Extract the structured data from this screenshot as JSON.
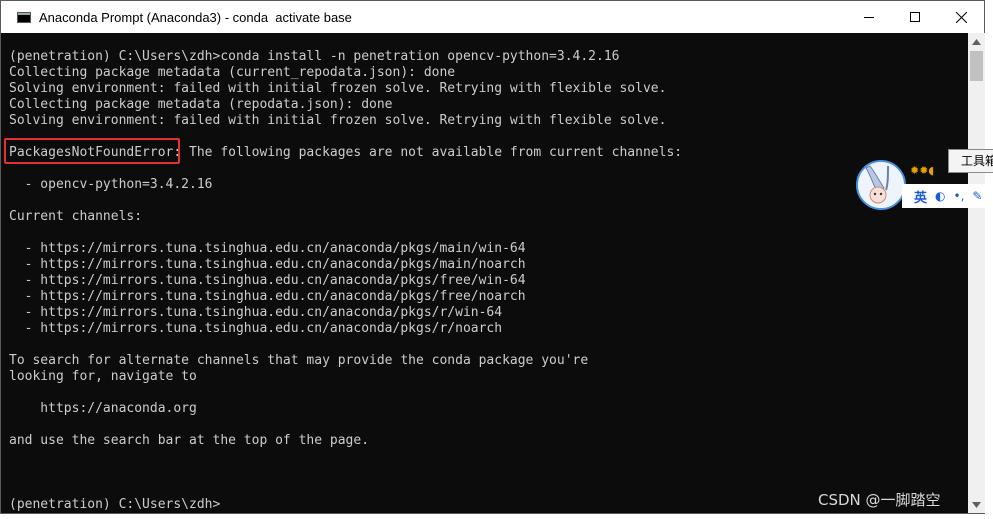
{
  "window": {
    "title": "Anaconda Prompt (Anaconda3) - conda  activate base",
    "minimize_glyph": "minimize-icon",
    "maximize_glyph": "maximize-icon",
    "close_glyph": "close-icon"
  },
  "console": {
    "lines": [
      "(penetration) C:\\Users\\zdh>conda install -n penetration opencv-python=3.4.2.16",
      "Collecting package metadata (current_repodata.json): done",
      "Solving environment: failed with initial frozen solve. Retrying with flexible solve.",
      "Collecting package metadata (repodata.json): done",
      "Solving environment: failed with initial frozen solve. Retrying with flexible solve.",
      "",
      "PackagesNotFoundError: The following packages are not available from current channels:",
      "",
      "  - opencv-python=3.4.2.16",
      "",
      "Current channels:",
      "",
      "  - https://mirrors.tuna.tsinghua.edu.cn/anaconda/pkgs/main/win-64",
      "  - https://mirrors.tuna.tsinghua.edu.cn/anaconda/pkgs/main/noarch",
      "  - https://mirrors.tuna.tsinghua.edu.cn/anaconda/pkgs/free/win-64",
      "  - https://mirrors.tuna.tsinghua.edu.cn/anaconda/pkgs/free/noarch",
      "  - https://mirrors.tuna.tsinghua.edu.cn/anaconda/pkgs/r/win-64",
      "  - https://mirrors.tuna.tsinghua.edu.cn/anaconda/pkgs/r/noarch",
      "",
      "To search for alternate channels that may provide the conda package you're",
      "looking for, navigate to",
      "",
      "    https://anaconda.org",
      "",
      "and use the search bar at the top of the page.",
      "",
      "",
      "",
      "(penetration) C:\\Users\\zdh>"
    ],
    "highlighted_error": "PackagesNotFoundError",
    "highlight_color": "#e03030",
    "text_color": "#cccccc",
    "background_color": "#0c0c0c"
  },
  "ime": {
    "language": "英",
    "tooltip": "工具箱"
  },
  "watermark": "CSDN @一脚踏空",
  "colors": {
    "accent_blue": "#1a5bd6"
  }
}
